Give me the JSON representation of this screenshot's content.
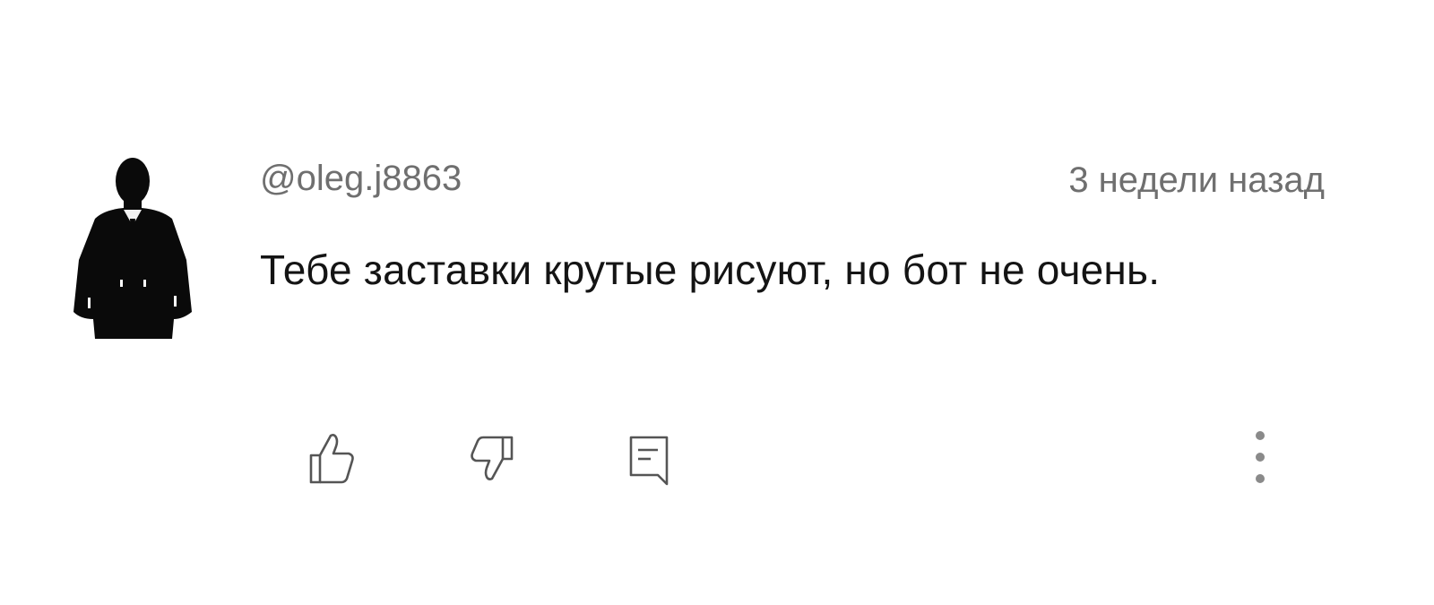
{
  "comment": {
    "author": "@oleg.j8863",
    "timestamp": "3 недели назад",
    "text": "Тебе заставки крутые рисуют, но бот не очень."
  },
  "icons": {
    "avatar": "person-in-suit-silhouette",
    "like": "thumbs-up-icon",
    "dislike": "thumbs-down-icon",
    "reply": "comment-reply-icon",
    "more": "more-vertical-icon"
  },
  "colors": {
    "background": "#ffffff",
    "text_primary": "#141414",
    "text_secondary": "#6f6f6f",
    "icon": "#555555"
  }
}
